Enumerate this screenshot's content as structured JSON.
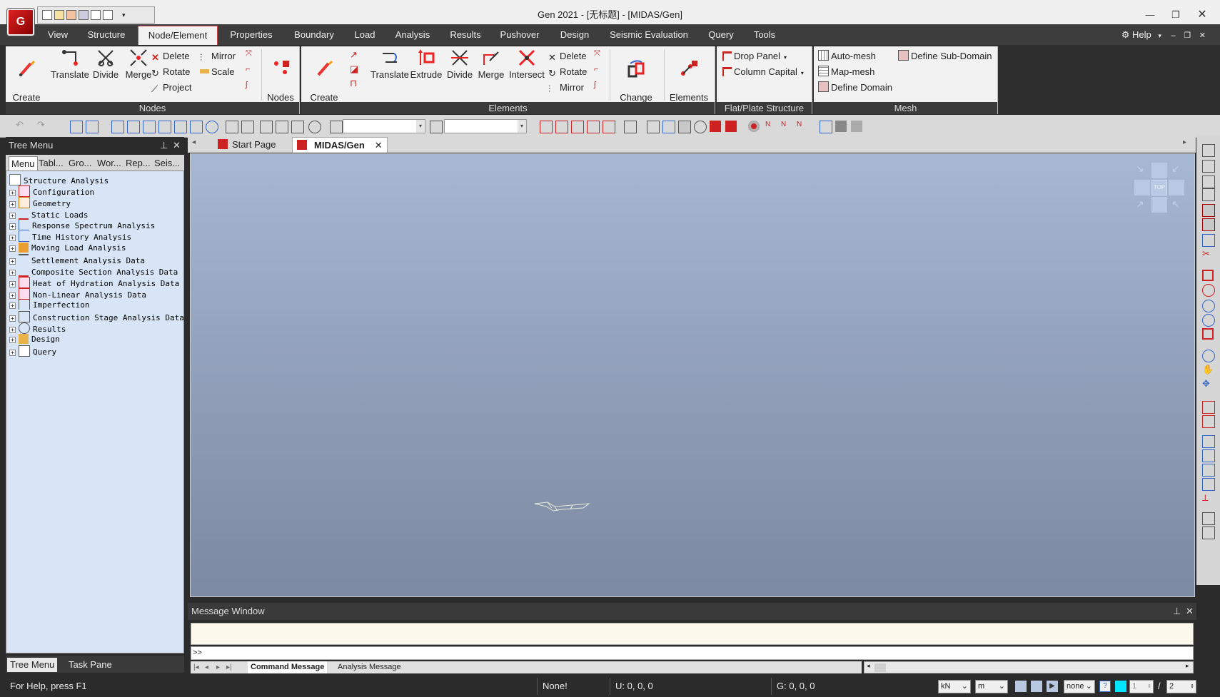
{
  "window": {
    "title": "Gen 2021 - [无标题] - [MIDAS/Gen]",
    "logo_text": "G"
  },
  "ribbon_tabs": [
    "View",
    "Structure",
    "Node/Element",
    "Properties",
    "Boundary",
    "Load",
    "Analysis",
    "Results",
    "Pushover",
    "Design",
    "Seismic Evaluation",
    "Query",
    "Tools"
  ],
  "active_tab": "Node/Element",
  "help_label": "Help",
  "ribbon": {
    "nodes_group": {
      "label": "Nodes",
      "create_nodes": "Create\nNodes",
      "translate": "Translate",
      "divide": "Divide",
      "merge": "Merge",
      "delete": "Delete",
      "rotate": "Rotate",
      "project": "Project",
      "mirror": "Mirror",
      "scale": "Scale",
      "nodes_table": "Nodes\nTable"
    },
    "elements_group": {
      "label": "Elements",
      "create_elements": "Create\nElements",
      "translate": "Translate",
      "extrude": "Extrude",
      "divide": "Divide",
      "merge": "Merge",
      "intersect": "Intersect",
      "delete": "Delete",
      "rotate": "Rotate",
      "mirror": "Mirror",
      "change_parameters": "Change\nParameters",
      "elements_table": "Elements\nTable"
    },
    "flat_plate_group": {
      "label": "Flat/Plate Structure",
      "drop_panel": "Drop Panel",
      "column_capital": "Column Capital"
    },
    "mesh_group": {
      "label": "Mesh",
      "auto_mesh": "Auto-mesh",
      "map_mesh": "Map-mesh",
      "define_domain": "Define Domain",
      "define_sub_domain": "Define Sub-Domain"
    }
  },
  "tree_menu": {
    "title": "Tree Menu",
    "tabs": [
      "Menu",
      "Tabl...",
      "Gro...",
      "Wor...",
      "Rep...",
      "Seis..."
    ],
    "root": "Structure Analysis",
    "items": [
      "Configuration",
      "Geometry",
      "Static Loads",
      "Response Spectrum Analysis",
      "Time History Analysis",
      "Moving Load Analysis",
      "Settlement Analysis Data",
      "Composite Section Analysis Data",
      "Heat of Hydration Analysis Data",
      "Non-Linear Analysis Data",
      "Imperfection",
      "Construction Stage Analysis Data",
      "Results",
      "Design",
      "Query"
    ],
    "bottom_tabs": [
      "Tree Menu",
      "Task Pane"
    ]
  },
  "doc_tabs": [
    "Start Page",
    "MIDAS/Gen"
  ],
  "view_cube_label": "TOP",
  "message_window": {
    "title": "Message Window",
    "prompt": ">>",
    "tabs": [
      "Command Message",
      "Analysis Message"
    ]
  },
  "status": {
    "help_text": "For Help, press F1",
    "selection": "None!",
    "ucs": "U: 0, 0, 0",
    "gcs": "G: 0, 0, 0",
    "force_unit": "kN",
    "length_unit": "m",
    "filter": "none",
    "page_current": "1",
    "page_total": "2"
  },
  "colors": {
    "ribbon_bg": "#f2f2f2",
    "dark_chrome": "#3d3d3d",
    "viewport_top": "#a7b8d4",
    "viewport_bottom": "#7c89a2",
    "tree_bg": "#d8e5f7",
    "accent_red": "#cc2222"
  }
}
